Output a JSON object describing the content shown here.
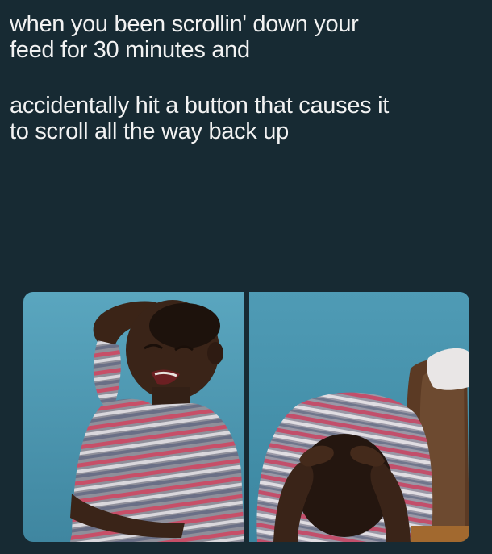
{
  "caption_top": {
    "lines": [
      "when you been scrollin' down your",
      "feed for 30 minutes and"
    ]
  },
  "caption_bottom": {
    "lines": [
      "accidentally hit a button that causes it",
      "to scroll all the way back up"
    ]
  },
  "colors": {
    "background": "#172a33",
    "text": "#f2f2f2",
    "photo_wall": "#4f9bb5"
  },
  "photos": [
    {
      "subject": "crying-boy-arm-raised"
    },
    {
      "subject": "boy-head-in-hands"
    }
  ]
}
